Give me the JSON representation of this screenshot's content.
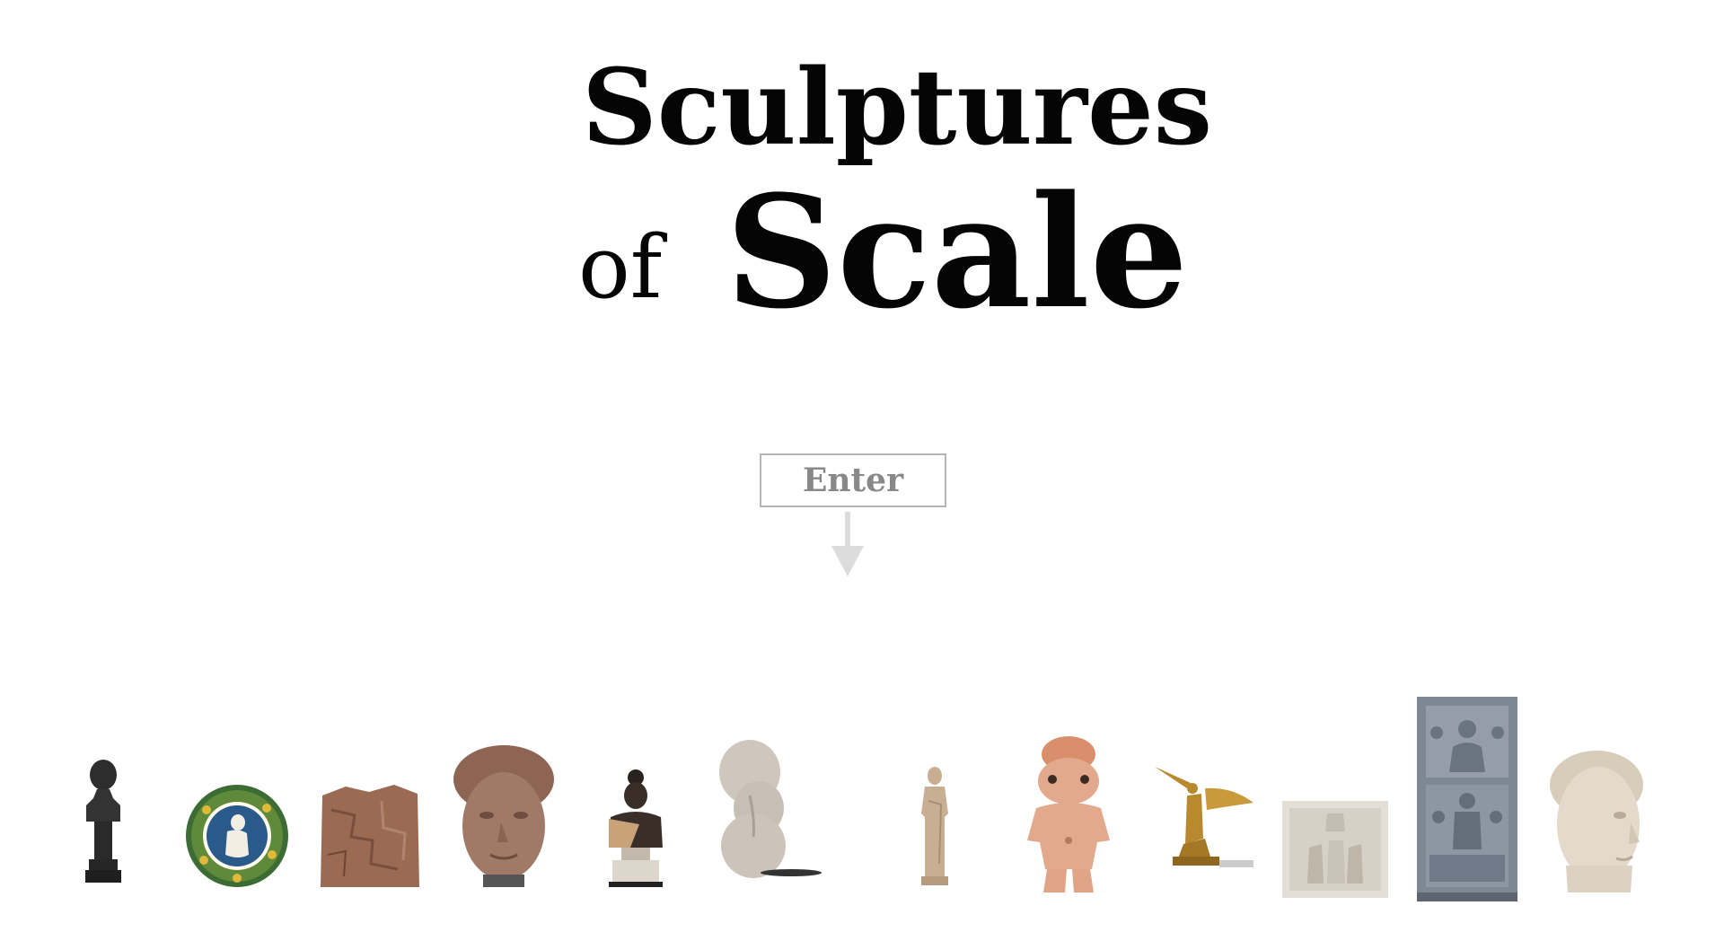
{
  "title": {
    "line1": "Sculptures",
    "of": "of",
    "scale": "Scale"
  },
  "enter": {
    "label": "Enter"
  },
  "sculptures": [
    {
      "name": "bust-sculpture",
      "color": "#2d2d2d"
    },
    {
      "name": "roundel-sculpture",
      "color": "#2a5a8a"
    },
    {
      "name": "relief-fragment-sculpture",
      "color": "#9a6a52"
    },
    {
      "name": "head-sculpture",
      "color": "#a07a66"
    },
    {
      "name": "bronze-bust-sculpture",
      "color": "#3a2e28"
    },
    {
      "name": "venus-figurine-sculpture",
      "color": "#cfc7bd"
    },
    {
      "name": "standing-figure-sculpture",
      "color": "#c8ae92"
    },
    {
      "name": "terracotta-figurine-sculpture",
      "color": "#e2a98c"
    },
    {
      "name": "winged-victory-sculpture",
      "color": "#b8892e"
    },
    {
      "name": "marble-relief-panel-sculpture",
      "color": "#e3dfd6"
    },
    {
      "name": "stele-relief-sculpture",
      "color": "#7e8794"
    },
    {
      "name": "marble-head-sculpture",
      "color": "#e4dacb"
    }
  ]
}
